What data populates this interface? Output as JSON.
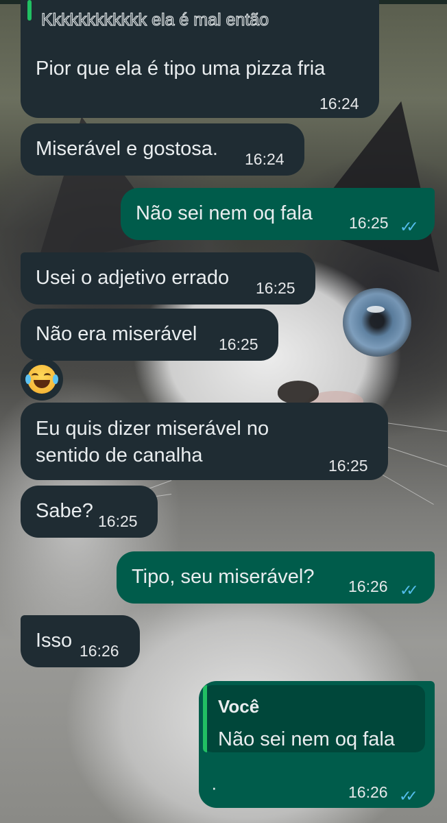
{
  "messages": [
    {
      "id": "m1",
      "text": "Pior que ela é tipo uma pizza fria",
      "time": "16:24"
    },
    {
      "id": "m2",
      "text": "Miserável e gostosa.",
      "time": "16:24"
    },
    {
      "id": "m3",
      "text": "Não sei nem oq fala",
      "time": "16:25",
      "ticks": "✓✓"
    },
    {
      "id": "m4",
      "text": "Usei o adjetivo errado",
      "time": "16:25"
    },
    {
      "id": "m5",
      "text": "Não era miserável",
      "time": "16:25"
    },
    {
      "id": "m6",
      "line1": "Eu quis dizer miserável no",
      "line2": "sentido de canalha",
      "time": "16:25"
    },
    {
      "id": "m7",
      "text": "Sabe?",
      "time": "16:25"
    },
    {
      "id": "m8",
      "text": "Tipo, seu miserável?",
      "time": "16:26",
      "ticks": "✓✓"
    },
    {
      "id": "m9",
      "text": "Isso",
      "time": "16:26"
    },
    {
      "id": "m10",
      "quote_author": "Você",
      "quote_text": "Não sei nem oq fala",
      "text": "·",
      "time": "16:26",
      "ticks": "✓✓"
    }
  ],
  "quoted_top": {
    "text": "Kkkkkkkkkkkk ela é mal então"
  },
  "reaction": {
    "emoji_name": "face-with-tears-of-joy"
  },
  "colors": {
    "incoming_bubble": "#1f2c33",
    "outgoing_bubble": "#005c4b",
    "read_ticks": "#53bdeb",
    "quote_bar": "#21c063"
  }
}
